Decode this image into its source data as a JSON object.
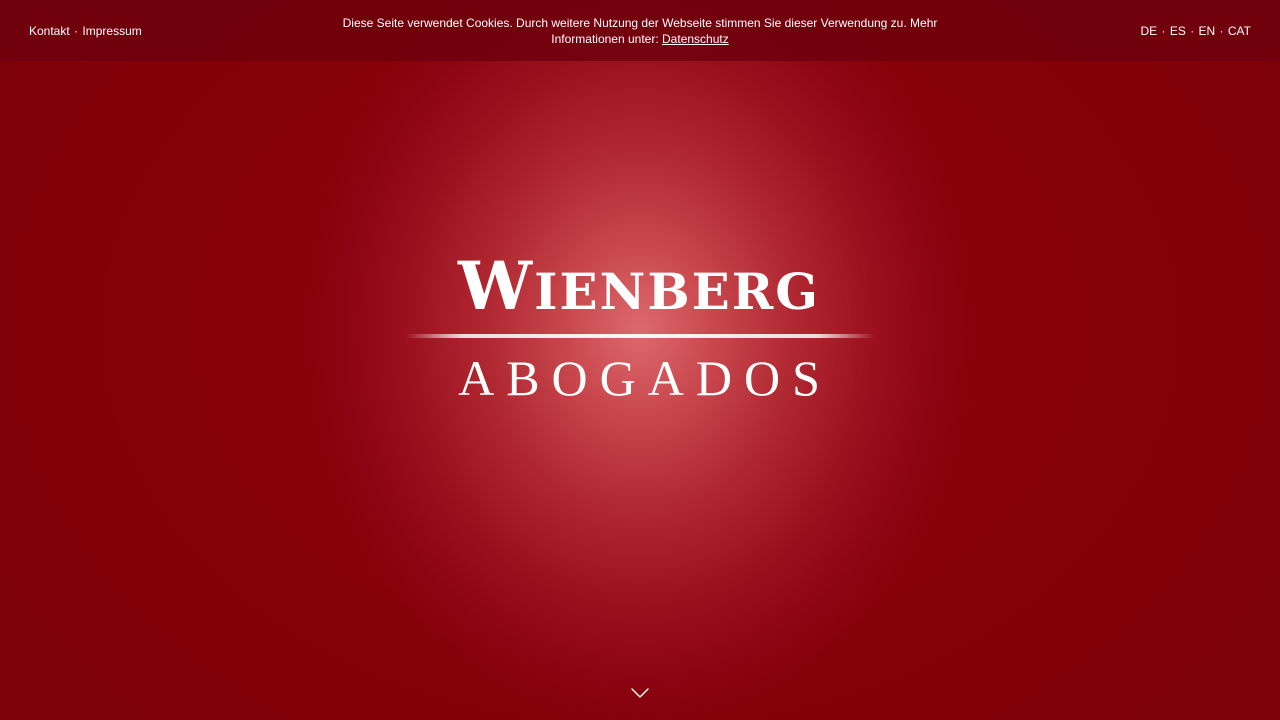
{
  "header": {
    "left_links": [
      {
        "label": "Kontakt"
      },
      {
        "label": "Impressum"
      }
    ],
    "separator": "·",
    "cookie_notice": {
      "text": "Diese Seite verwendet Cookies. Durch weitere Nutzung der Webseite stimmen Sie dieser Verwendung zu. Mehr Informationen unter: ",
      "link_label": "Datenschutz"
    },
    "languages": [
      {
        "label": "DE"
      },
      {
        "label": "ES"
      },
      {
        "label": "EN"
      },
      {
        "label": "CAT"
      }
    ]
  },
  "logo": {
    "main_initial": "W",
    "main_rest": "IENBERG",
    "sub": "ABOGADOS"
  },
  "scroll_indicator": {
    "icon": "chevron-down-icon"
  },
  "colors": {
    "background": "#8c0411",
    "glow": "#dc6a6d",
    "topbar": "#6c000c",
    "text": "#ffffff"
  }
}
